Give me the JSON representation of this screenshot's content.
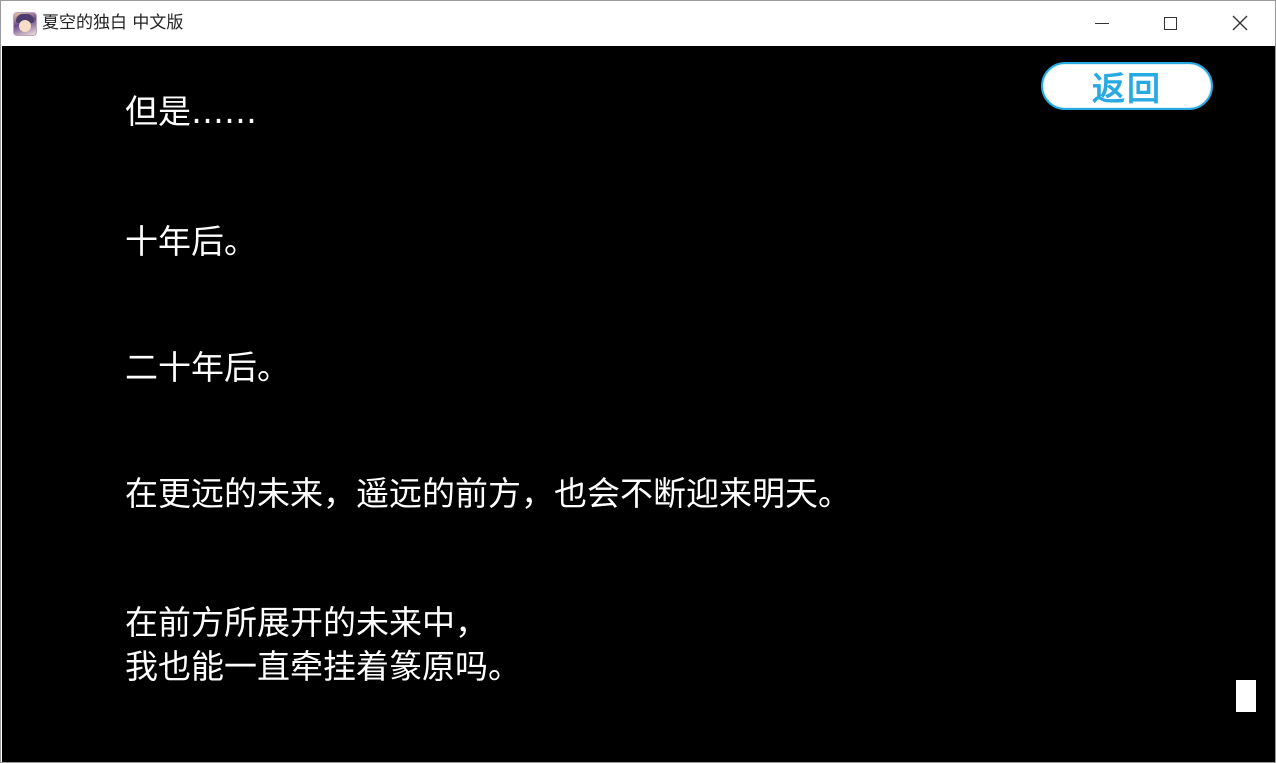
{
  "window": {
    "title": "夏空的独白 中文版",
    "icon": "app-icon",
    "controls": [
      "minimize-icon",
      "maximize-icon",
      "close-icon"
    ]
  },
  "game": {
    "back_button_label": "返回",
    "accent_color": "#27a9e1",
    "background_color": "#000000",
    "text_color": "#ffffff",
    "lines": [
      "但是……",
      "十年后。",
      "二十年后。",
      "在更远的未来，遥远的前方，也会不断迎来明天。",
      "在前方所展开的未来中，",
      "我也能一直牵挂着篆原吗。"
    ]
  }
}
